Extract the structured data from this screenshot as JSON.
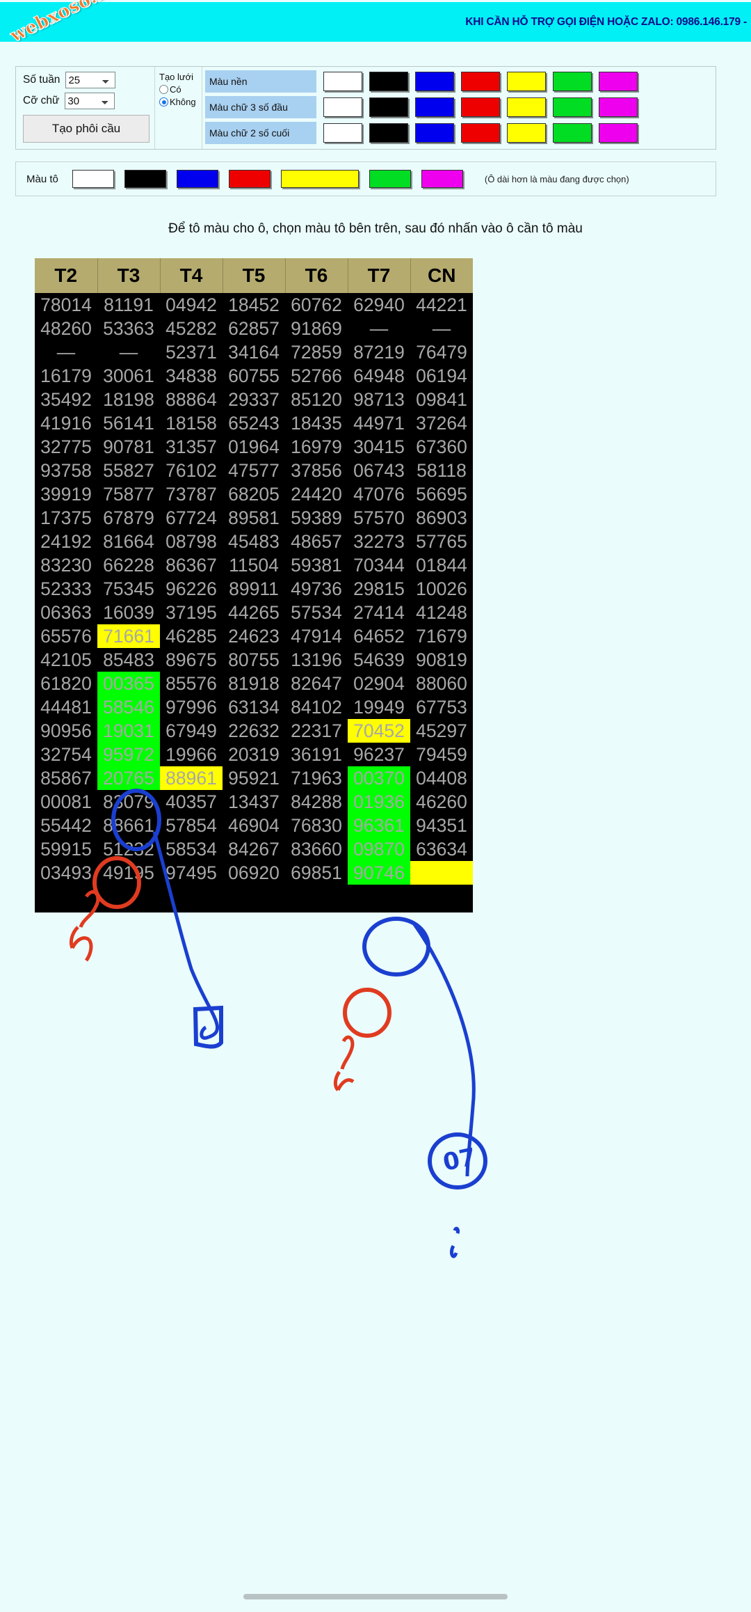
{
  "banner": {
    "watermark": "webxoso.net",
    "support_text": "KHI CẦN HỖ TRỢ GỌI ĐIỆN HOẶC ZALO: 0986.146.179 -"
  },
  "panel": {
    "week_label": "Số tuần",
    "week_value": "25",
    "font_label": "Cỡ chữ",
    "font_value": "30",
    "create_button": "Tạo phôi cầu",
    "grid_title": "Tạo lưới",
    "grid_yes": "Có",
    "grid_no": "Không",
    "grid_selected": "Không",
    "color_rows": [
      {
        "label": "Màu nền",
        "swatches": [
          "#ffffff",
          "#000000",
          "#0000ee",
          "#ee0000",
          "#ffff00",
          "#00dd22",
          "#ee00ee"
        ]
      },
      {
        "label": "Màu chữ 3 số đầu",
        "swatches": [
          "#ffffff",
          "#000000",
          "#0000ee",
          "#ee0000",
          "#ffff00",
          "#00dd22",
          "#ee00ee"
        ]
      },
      {
        "label": "Màu chữ 2 số cuối",
        "swatches": [
          "#ffffff",
          "#000000",
          "#0000ee",
          "#ee0000",
          "#ffff00",
          "#00dd22",
          "#ee00ee"
        ]
      }
    ]
  },
  "fillbar": {
    "label": "Màu tô",
    "swatches": [
      "#ffffff",
      "#000000",
      "#0000ee",
      "#ee0000",
      "#ffff00",
      "#00dd22",
      "#ee00ee"
    ],
    "selected_index": 4,
    "note": "(Ô dài hơn là màu đang được chọn)"
  },
  "hint": "Để tô màu cho ô, chọn màu tô bên trên, sau đó nhấn vào ô cần tô màu",
  "table": {
    "headers": [
      "T2",
      "T3",
      "T4",
      "T5",
      "T6",
      "T7",
      "CN"
    ],
    "rows": [
      [
        "78014",
        "81191",
        "04942",
        "18452",
        "60762",
        "62940",
        "44221"
      ],
      [
        "48260",
        "53363",
        "45282",
        "62857",
        "91869",
        "—",
        "—"
      ],
      [
        "—",
        "—",
        "52371",
        "34164",
        "72859",
        "87219",
        "76479"
      ],
      [
        "16179",
        "30061",
        "34838",
        "60755",
        "52766",
        "64948",
        "06194"
      ],
      [
        "35492",
        "18198",
        "88864",
        "29337",
        "85120",
        "98713",
        "09841"
      ],
      [
        "41916",
        "56141",
        "18158",
        "65243",
        "18435",
        "44971",
        "37264"
      ],
      [
        "32775",
        "90781",
        "31357",
        "01964",
        "16979",
        "30415",
        "67360"
      ],
      [
        "93758",
        "55827",
        "76102",
        "47577",
        "37856",
        "06743",
        "58118"
      ],
      [
        "39919",
        "75877",
        "73787",
        "68205",
        "24420",
        "47076",
        "56695"
      ],
      [
        "17375",
        "67879",
        "67724",
        "89581",
        "59389",
        "57570",
        "86903"
      ],
      [
        "24192",
        "81664",
        "08798",
        "45483",
        "48657",
        "32273",
        "57765"
      ],
      [
        "83230",
        "66228",
        "86367",
        "11504",
        "59381",
        "70344",
        "01844"
      ],
      [
        "52333",
        "75345",
        "96226",
        "89911",
        "49736",
        "29815",
        "10026"
      ],
      [
        "06363",
        "16039",
        "37195",
        "44265",
        "57534",
        "27414",
        "41248"
      ],
      [
        "65576",
        "71661",
        "46285",
        "24623",
        "47914",
        "64652",
        "71679"
      ],
      [
        "42105",
        "85483",
        "89675",
        "80755",
        "13196",
        "54639",
        "90819"
      ],
      [
        "61820",
        "00365",
        "85576",
        "81918",
        "82647",
        "02904",
        "88060"
      ],
      [
        "44481",
        "58546",
        "97996",
        "63134",
        "84102",
        "19949",
        "67753"
      ],
      [
        "90956",
        "19031",
        "67949",
        "22632",
        "22317",
        "70452",
        "45297"
      ],
      [
        "32754",
        "95972",
        "19966",
        "20319",
        "36191",
        "96237",
        "79459"
      ],
      [
        "85867",
        "20765",
        "88961",
        "95921",
        "71963",
        "00370",
        "04408"
      ],
      [
        "00081",
        "83079",
        "40357",
        "13437",
        "84288",
        "01936",
        "46260"
      ],
      [
        "55442",
        "88661",
        "57854",
        "46904",
        "76830",
        "96361",
        "94351"
      ],
      [
        "59915",
        "51232",
        "58534",
        "84267",
        "83660",
        "09870",
        "63634"
      ],
      [
        "03493",
        "49195",
        "97495",
        "06920",
        "69851",
        "90746",
        ""
      ]
    ],
    "fills": [
      {
        "row": 14,
        "col": 1,
        "color": "yellow"
      },
      {
        "row": 16,
        "col": 1,
        "color": "green"
      },
      {
        "row": 17,
        "col": 1,
        "color": "green"
      },
      {
        "row": 18,
        "col": 1,
        "color": "green"
      },
      {
        "row": 19,
        "col": 1,
        "color": "green"
      },
      {
        "row": 20,
        "col": 1,
        "color": "green"
      },
      {
        "row": 20,
        "col": 2,
        "color": "yellow"
      },
      {
        "row": 18,
        "col": 5,
        "color": "yellow"
      },
      {
        "row": 20,
        "col": 5,
        "color": "green"
      },
      {
        "row": 21,
        "col": 5,
        "color": "green"
      },
      {
        "row": 22,
        "col": 5,
        "color": "green"
      },
      {
        "row": 23,
        "col": 5,
        "color": "green"
      },
      {
        "row": 24,
        "col": 5,
        "color": "green"
      },
      {
        "row": 24,
        "col": 6,
        "color": "yellow"
      }
    ]
  },
  "annotations": {
    "blue_mark_bottom": "07",
    "red_mark_left": "man",
    "red_mark_right": "ma",
    "colors": {
      "blue": "#1a3fd0",
      "red": "#e03b20"
    }
  }
}
